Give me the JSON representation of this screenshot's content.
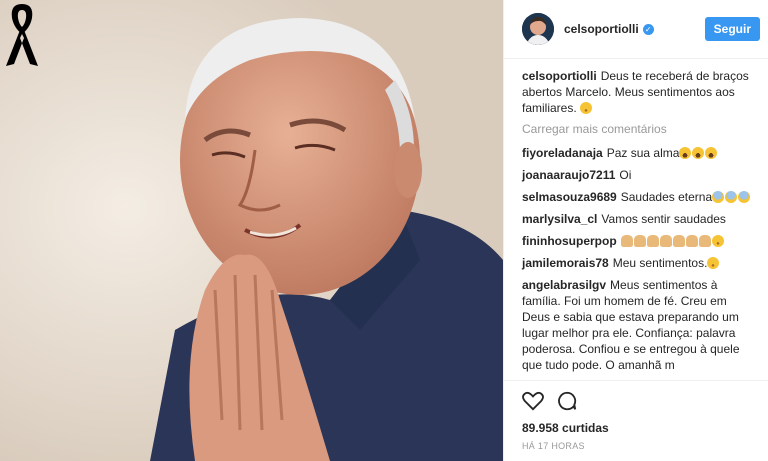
{
  "post": {
    "author": "celsoportiolli",
    "follow_label": "Seguir",
    "caption_user": "celsoportiolli",
    "caption_text": "Deus te receberá de braços abertos Marcelo. Meus sentimentos aos familiares.",
    "load_more": "Carregar mais comentários",
    "likes": "89.958 curtidas",
    "time": "HÁ 17 HORAS"
  },
  "comments": [
    {
      "user": "fiyoreladanaja",
      "text": "Paz sua alma",
      "emoji": [
        "fear",
        "fear",
        "fear"
      ]
    },
    {
      "user": "joanaaraujo7211",
      "text": "Oi",
      "emoji": []
    },
    {
      "user": "selmasouza9689",
      "text": "Saudades eterna",
      "emoji": [
        "blue",
        "blue",
        "blue"
      ]
    },
    {
      "user": "marlysilva_cl",
      "text": "Vamos sentir saudades",
      "emoji": []
    },
    {
      "user": "fininhosuperpop",
      "text": "",
      "emoji": [
        "pray",
        "pray",
        "pray",
        "pray",
        "pray",
        "pray",
        "pray",
        "worry"
      ]
    },
    {
      "user": "jamilemorais78",
      "text": "Meu sentimentos.",
      "emoji": [
        "worry"
      ]
    },
    {
      "user": "angelabrasilgv",
      "text": "Meus sentimentos à família. Foi um homem de fé. Creu em Deus e sabia que estava preparando um lugar melhor pra ele. Confiança: palavra poderosa. Confiou e se entregou à quele que tudo pode. O amanhã m",
      "emoji": []
    }
  ],
  "icons": [
    "black-ribbon-icon",
    "verified-icon",
    "heart-icon",
    "comment-icon"
  ],
  "colors": {
    "accent": "#3897f0",
    "text": "#262626",
    "muted": "#999999"
  }
}
